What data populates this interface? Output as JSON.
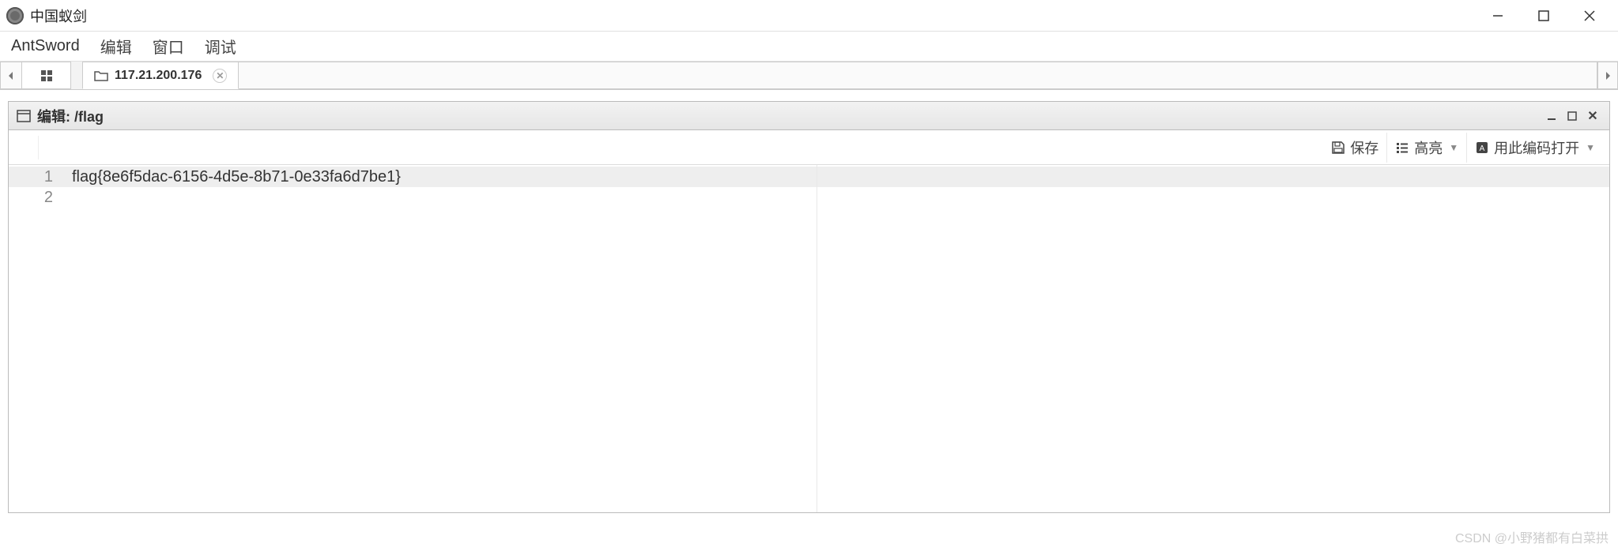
{
  "window": {
    "title": "中国蚁剑"
  },
  "menu": {
    "brand": "AntSword",
    "items": [
      "编辑",
      "窗口",
      "调试"
    ]
  },
  "tabs": {
    "active": {
      "label": "117.21.200.176"
    }
  },
  "panel": {
    "title": "编辑: /flag"
  },
  "toolbar": {
    "save": "保存",
    "highlight": "高亮",
    "encoding": "用此编码打开"
  },
  "editor": {
    "lines": [
      "flag{8e6f5dac-6156-4d5e-8b71-0e33fa6d7be1}",
      ""
    ]
  },
  "watermark": "CSDN @小野猪都有白菜拱"
}
